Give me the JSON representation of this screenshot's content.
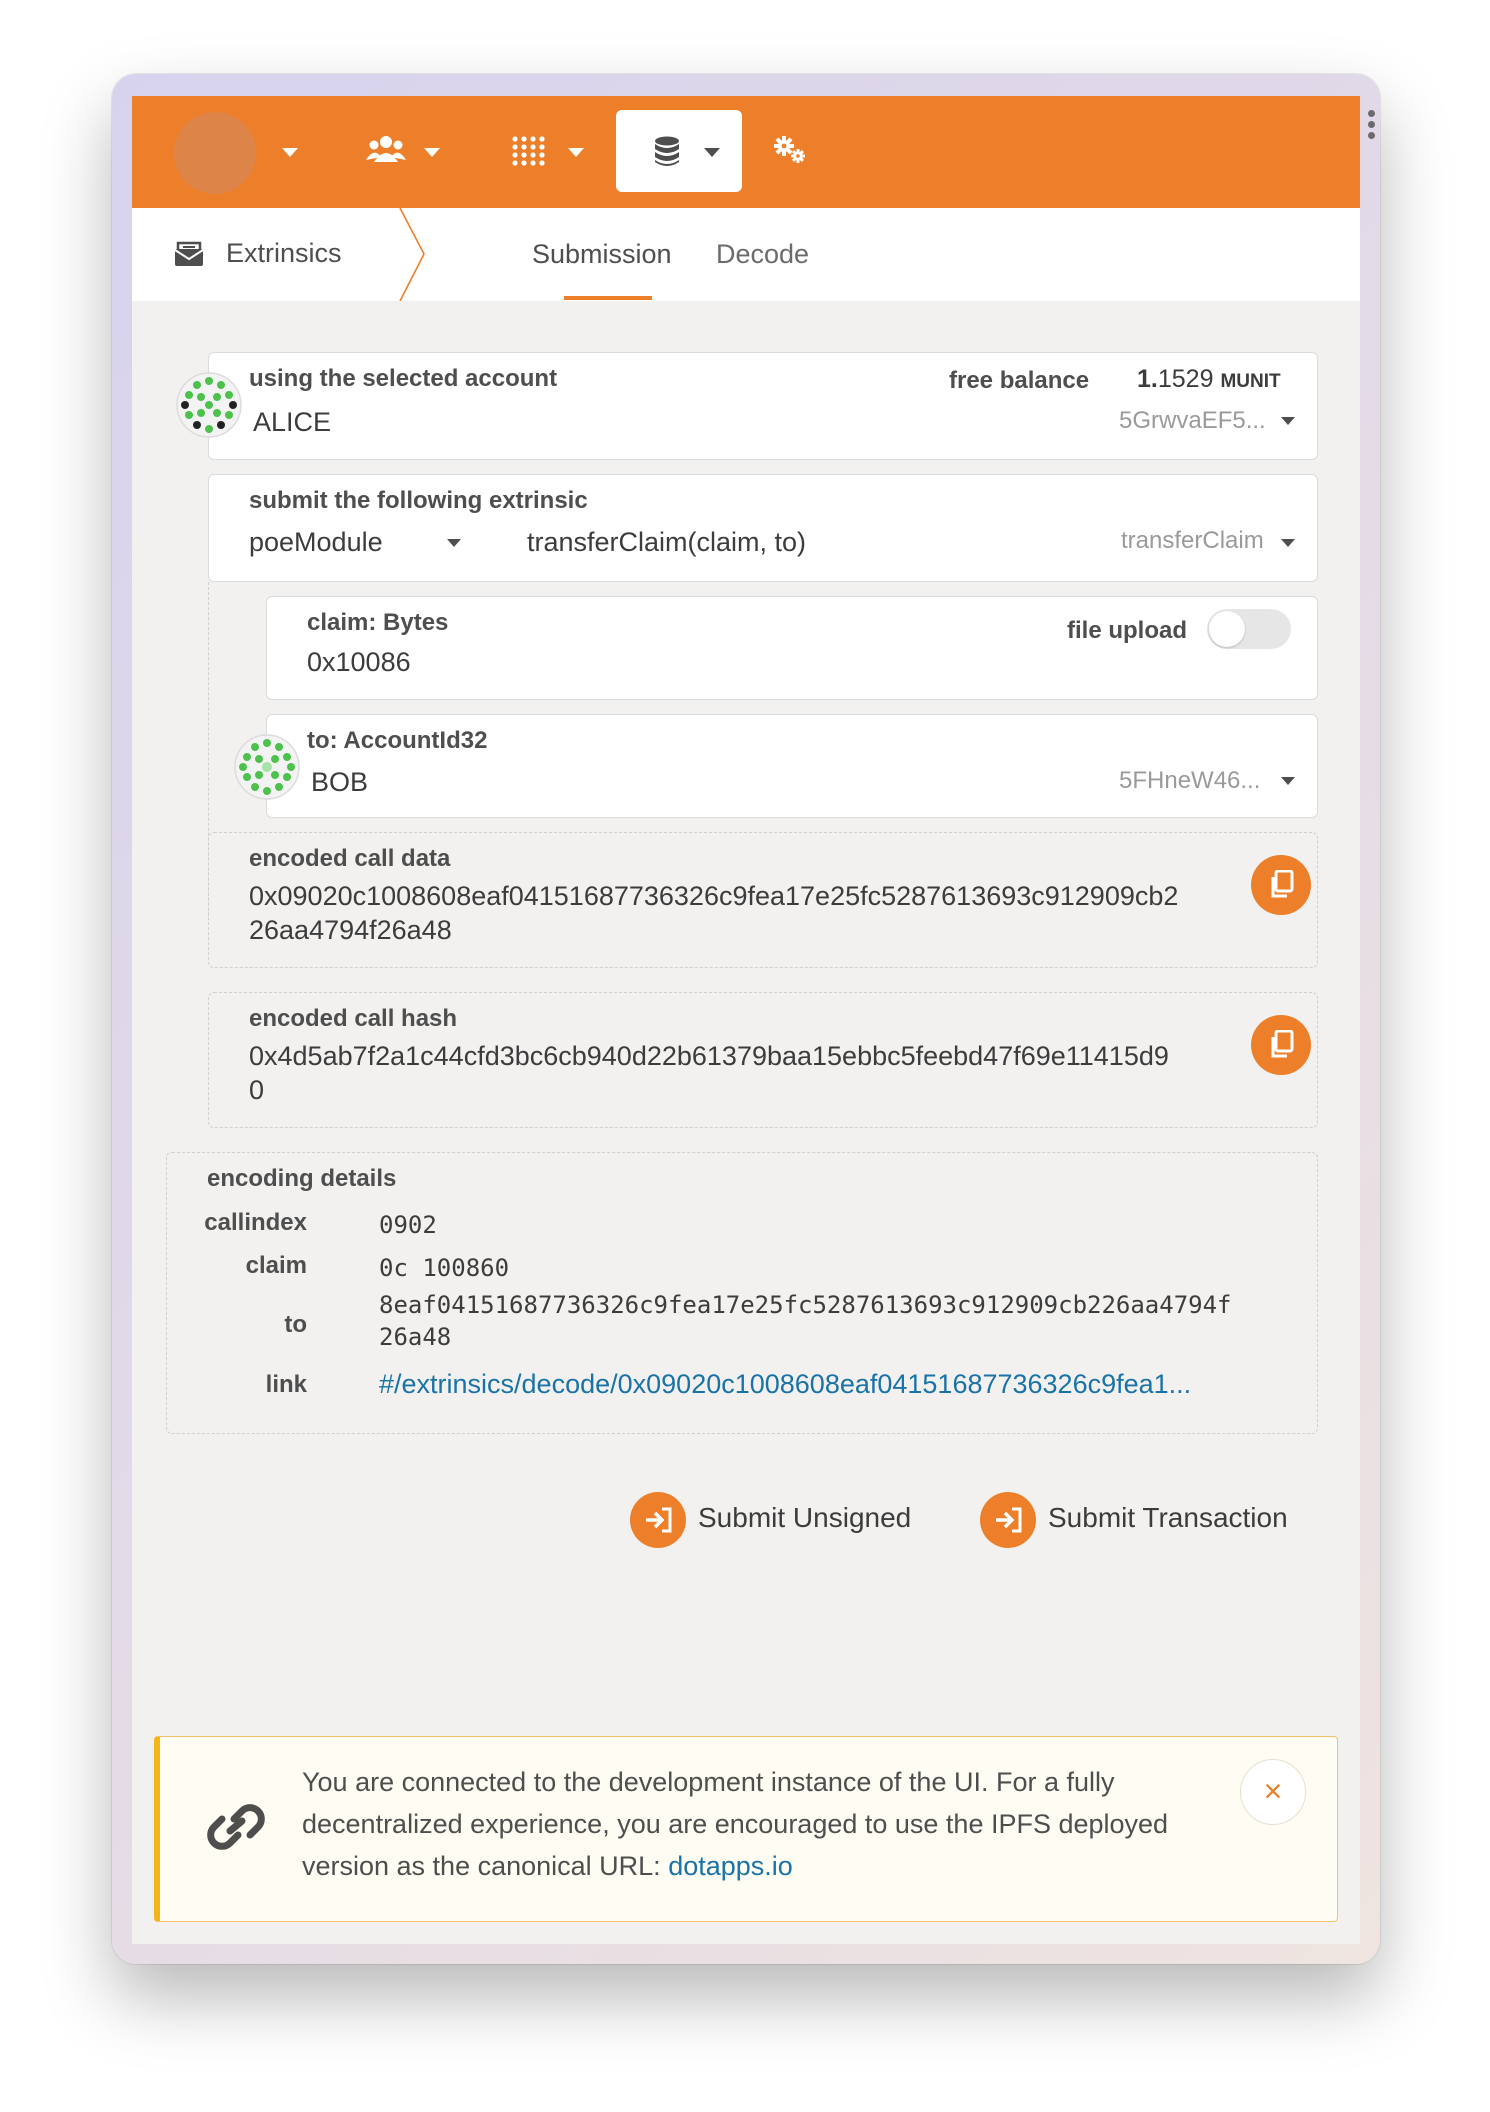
{
  "nav": {
    "items": [
      {
        "icon": "avatar"
      },
      {
        "icon": "accounts-icon"
      },
      {
        "icon": "network-icon"
      },
      {
        "icon": "developer-icon",
        "selected": true
      },
      {
        "icon": "settings-icon"
      }
    ]
  },
  "header": {
    "title": "Extrinsics",
    "tabs": [
      {
        "label": "Submission",
        "active": true
      },
      {
        "label": "Decode",
        "active": false
      }
    ]
  },
  "account": {
    "label": "using the selected account",
    "name": "ALICE",
    "balance_label": "free balance",
    "balance_int": "1.",
    "balance_frac": "1529",
    "balance_unit": "MUNIT",
    "address": "5GrwvaEF5..."
  },
  "extrinsic": {
    "label": "submit the following extrinsic",
    "module": "poeModule",
    "call": "transferClaim(claim, to)",
    "method": "transferClaim"
  },
  "claim": {
    "label": "claim: Bytes",
    "value": "0x10086",
    "upload_label": "file upload"
  },
  "to": {
    "label": "to: AccountId32",
    "name": "BOB",
    "address": "5FHneW46..."
  },
  "call_data": {
    "label": "encoded call data",
    "line1": "0x09020c1008608eaf04151687736326c9fea17e25fc5287613693c912909cb2",
    "line2": "26aa4794f26a48"
  },
  "call_hash": {
    "label": "encoded call hash",
    "line1": "0x4d5ab7f2a1c44cfd3bc6cb940d22b61379baa15ebbc5feebd47f69e11415d9",
    "line2": "0"
  },
  "encoding": {
    "title": "encoding details",
    "callindex_label": "callindex",
    "callindex": "0902",
    "claim_label": "claim",
    "claim": "0c 100860",
    "to_label": "to",
    "to_line1": "8eaf04151687736326c9fea17e25fc5287613693c912909cb226aa4794f",
    "to_line2": "26a48",
    "link_label": "link",
    "link": "#/extrinsics/decode/0x09020c1008608eaf04151687736326c9fea1..."
  },
  "actions": {
    "unsigned": "Submit Unsigned",
    "transaction": "Submit Transaction"
  },
  "notice": {
    "text": "You are connected to the development instance of the UI. For a fully decentralized experience, you are encouraged to use the IPFS deployed version as the canonical URL: ",
    "link": "dotapps.io",
    "close": "×"
  },
  "colors": {
    "accent": "#ed7f2a",
    "link": "#1a73a8",
    "notice_border": "#f2b51a"
  }
}
